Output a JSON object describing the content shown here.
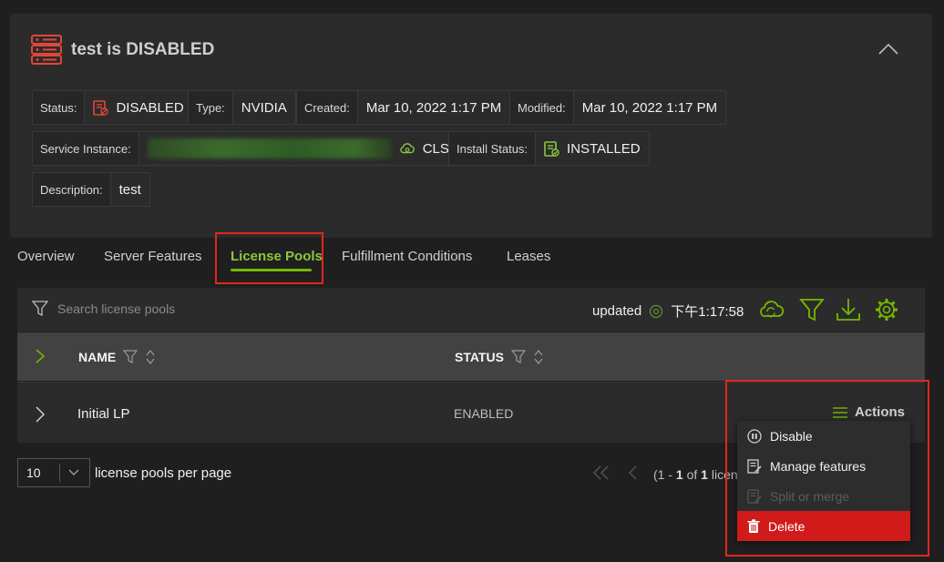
{
  "header": {
    "title": "test is DISABLED"
  },
  "fields": {
    "status": {
      "label": "Status:",
      "value": "DISABLED"
    },
    "type": {
      "label": "Type:",
      "value": "NVIDIA"
    },
    "created": {
      "label": "Created:",
      "value": "Mar 10, 2022 1:17 PM"
    },
    "modified": {
      "label": "Modified:",
      "value": "Mar 10, 2022 1:17 PM"
    },
    "service_instance": {
      "label": "Service Instance:",
      "value": "CLS"
    },
    "install_status": {
      "label": "Install Status:",
      "value": "INSTALLED"
    },
    "description": {
      "label": "Description:",
      "value": "test"
    }
  },
  "tabs": [
    {
      "label": "Overview"
    },
    {
      "label": "Server Features"
    },
    {
      "label": "License Pools"
    },
    {
      "label": "Fulfillment Conditions"
    },
    {
      "label": "Leases"
    }
  ],
  "toolbar": {
    "search_placeholder": "Search license pools",
    "updated_label": "updated",
    "updated_time": "下午1:17:58"
  },
  "table": {
    "columns": [
      {
        "label": "NAME"
      },
      {
        "label": "STATUS"
      }
    ],
    "rows": [
      {
        "name": "Initial LP",
        "status": "ENABLED"
      }
    ],
    "actions_label": "Actions"
  },
  "actions_menu": {
    "items": [
      {
        "label": "Disable",
        "icon": "disable-icon",
        "state": "enabled"
      },
      {
        "label": "Manage features",
        "icon": "manage-features-icon",
        "state": "enabled"
      },
      {
        "label": "Split or merge",
        "icon": "split-merge-icon",
        "state": "disabled"
      },
      {
        "label": "Delete",
        "icon": "trash-icon",
        "state": "danger"
      }
    ]
  },
  "pagination": {
    "per_page": "10",
    "per_page_label": "license pools per page",
    "count_prefix": "(1 - ",
    "count_a": "1",
    "count_mid": " of ",
    "count_b": "1",
    "count_suffix": " licen"
  },
  "colors": {
    "accent_green": "#76b900",
    "danger_red": "#d11a1a",
    "highlight_red": "#e0261d"
  }
}
